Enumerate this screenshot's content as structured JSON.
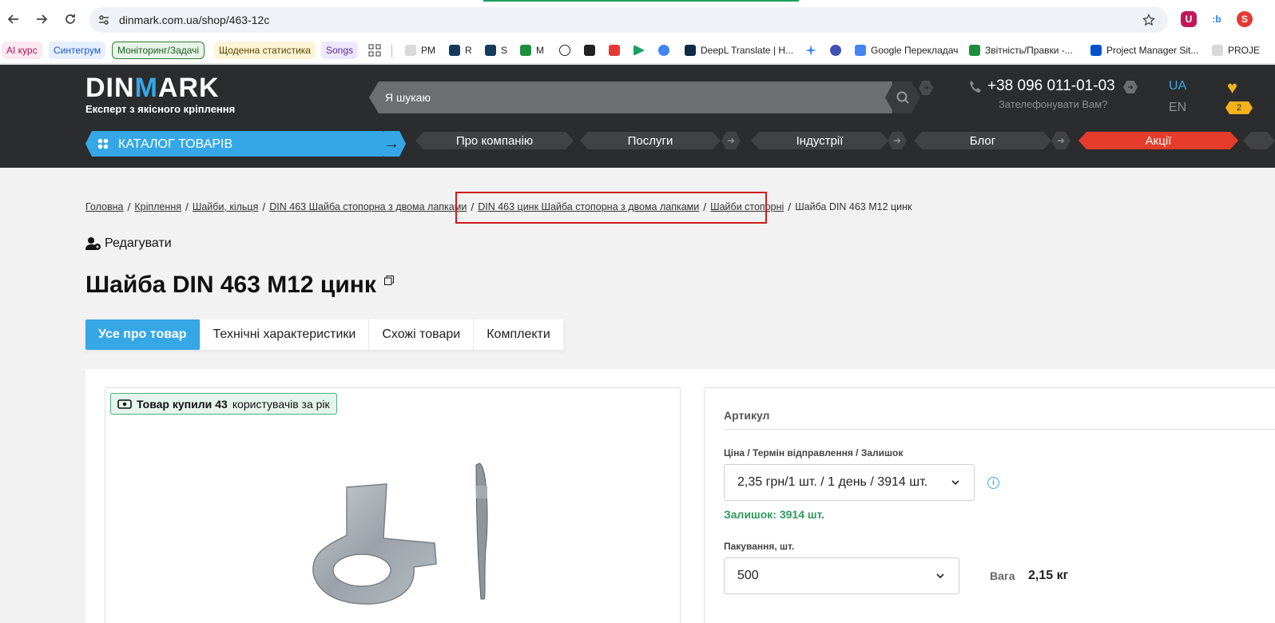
{
  "browser": {
    "url": "dinmark.com.ua/shop/463-12c",
    "bookmarks": {
      "ai": "AI курс",
      "sintegrum": "Синтегрум",
      "monitoring": "Моніторинг/Задачі",
      "daily": "Щоденна статистика",
      "songs": "Songs",
      "pm": "PM",
      "r": "R",
      "s": "S",
      "m": "M",
      "deepl": "DeepL Translate | H...",
      "gtranslate": "Google Перекладач",
      "reports": "Звітність/Правки -...",
      "pmsite": "Project Manager Sit...",
      "proj": "PROJE"
    },
    "colors": {
      "chip_ai": "#fde7f1",
      "chip_sintegrum": "#e6efff",
      "chip_monitoring": "#e8f5e9",
      "chip_daily": "#fff4d6",
      "chip_songs": "#efe6ff"
    }
  },
  "header": {
    "logo_prefix": "DIN",
    "logo_m": "M",
    "logo_suffix": "ARK",
    "tagline": "Експерт з якісного кріплення",
    "search_placeholder": "Я шукаю",
    "phone": "+38 096 011-01-03",
    "callback": "Зателефонувати Вам?",
    "lang_ua": "UA",
    "lang_en": "EN",
    "favorites_count": "2",
    "catalog": "КАТАЛОГ ТОВАРІВ",
    "nav": {
      "about": "Про компанію",
      "services": "Послуги",
      "industries": "Індустрії",
      "blog": "Блог",
      "promo": "Акції"
    },
    "colors": {
      "accent": "#35a7e7",
      "promo": "#e53c2b",
      "bg": "#2b2c2e"
    }
  },
  "breadcrumb": {
    "home": "Головна",
    "fasteners": "Кріплення",
    "washers": "Шайби, кільця",
    "din463": "DIN 463 Шайба стопорна з двома лапками",
    "din463zinc": "DIN 463 цинк Шайба стопорна з двома лапками",
    "lock_washers": "Шайби стопорні",
    "current": "Шайба DIN 463 M12 цинк"
  },
  "edit_label": "Редагувати",
  "product": {
    "title": "Шайба DIN 463 M12 цинк",
    "tabs": {
      "all": "Усе про товар",
      "specs": "Технічні характеристики",
      "similar": "Схожі товари",
      "kits": "Комплекти"
    },
    "bought_prefix": "Товар купили",
    "bought_count": "43",
    "bought_suffix": "користувачів за рік",
    "article_label": "Артикул",
    "price_label": "Ціна / Термін відправлення / Залишок",
    "price_option": "2,35 грн/1 шт. / 1 день / 3914 шт.",
    "stock": "Залишок: 3914 шт.",
    "pack_label": "Пакування, шт.",
    "pack_option": "500",
    "weight_label": "Вага",
    "weight_value": "2,15 кг"
  }
}
